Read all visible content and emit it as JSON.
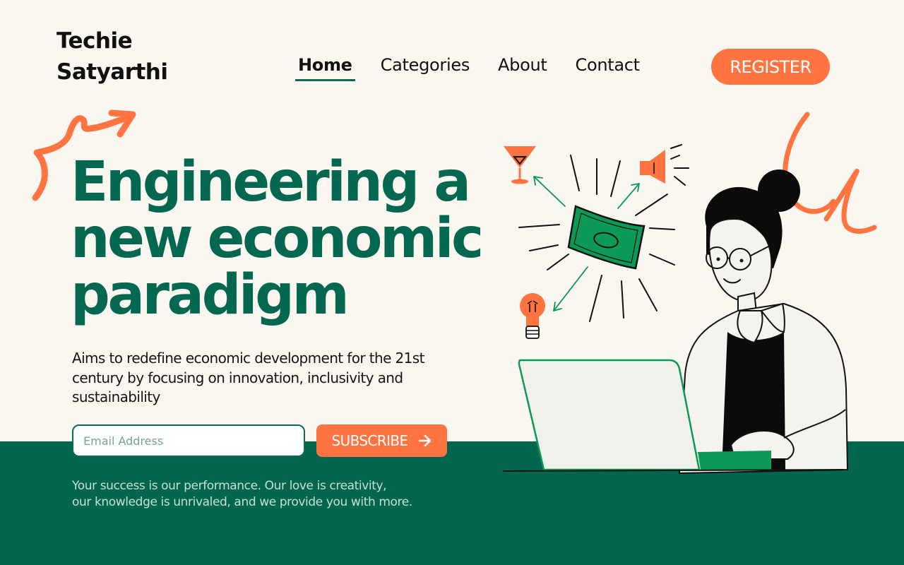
{
  "brand": {
    "line1": "Techie",
    "line2": "Satyarthi"
  },
  "nav": {
    "items": [
      {
        "label": "Home",
        "active": true
      },
      {
        "label": "Categories",
        "active": false
      },
      {
        "label": "About",
        "active": false
      },
      {
        "label": "Contact",
        "active": false
      }
    ]
  },
  "header": {
    "register_label": "REGISTER"
  },
  "hero": {
    "headline_line1": "Engineering a",
    "headline_line2": "new economic",
    "headline_line3": "paradigm",
    "description": "Aims to redefine economic development for the 21st century by focusing on innovation, inclusivity and sustainability"
  },
  "subscribe_form": {
    "email_placeholder": "Email Address",
    "email_value": "",
    "button_label": "SUBSCRIBE",
    "button_icon": "arrow-right-icon"
  },
  "footer": {
    "tagline_line1": "Your success is our performance. Our love is creativity,",
    "tagline_line2": "our knowledge is unrivaled, and we provide you with more."
  },
  "colors": {
    "background": "#faf7f0",
    "brand_green": "#02664d",
    "accent_orange": "#ff7441",
    "money_green": "#0a9a55"
  },
  "illustration": {
    "icons": [
      "martini-glass-icon",
      "megaphone-icon",
      "banknote-icon",
      "lightbulb-icon",
      "laptop-icon"
    ]
  }
}
